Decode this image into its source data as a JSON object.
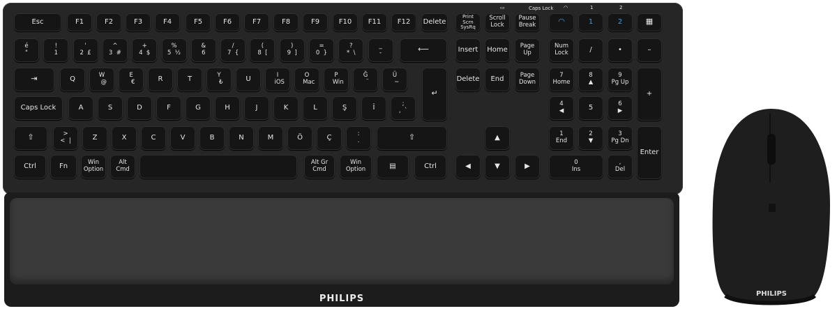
{
  "colors": {
    "keyboard": "#262626",
    "key": "#151515",
    "legend": "#e6e6e6",
    "bluetooth": "#3d9bea",
    "wrist_rest": "#3a3a3a",
    "mouse": "#1e1e1e"
  },
  "brand": {
    "keyboard": "PHILIPS",
    "mouse": "PHILIPS"
  },
  "indicators": {
    "caps_lock": "Caps Lock",
    "bt1": "1",
    "bt2": "2"
  },
  "keys": {
    "esc": "Esc",
    "f1": "F1",
    "f2": "F2",
    "f3": "F3",
    "f4": "F4",
    "f5": "F5",
    "f6": "F6",
    "f7": "F7",
    "f8": "F8",
    "f9": "F9",
    "f10": "F10",
    "f11": "F11",
    "f12": "F12",
    "delete_top": "Delete",
    "print": "Print\nScrn\nSysRq",
    "scroll": "Scroll\nLock",
    "pause": "Pause\nBreak",
    "bt1": "1",
    "bt2": "2",
    "r1": [
      "é\n\"",
      "!\n1",
      "'\n2  £",
      "^\n3  #",
      "+\n4  $",
      "%\n5  ½",
      "&\n6",
      "/\n7  {",
      "(\n8  [",
      ")\n9  ]",
      "=\n0  }",
      "?\n*  \\",
      "_\n-"
    ],
    "insert": "Insert",
    "home": "Home",
    "pgup": "Page\nUp",
    "numlock": "Num\nLock",
    "np_div": "/",
    "np_mul": "•",
    "np_min": "–",
    "r2": [
      "Q",
      "W\n  @",
      "E\n  €",
      "R",
      "T",
      "Y\n  ₺",
      "U",
      "I\n  iOS",
      "O\n  Mac",
      "P\n  Win",
      "Ğ\n  ¨",
      "Ü\n  ~"
    ],
    "del": "Delete",
    "end": "End",
    "pgdn": "Page\nDown",
    "np7": "7\nHome",
    "np8": "8\n▲",
    "np9": "9\nPg Up",
    "np_plus": "+",
    "caps": "Caps Lock",
    "r3": [
      "A",
      "S",
      "D",
      "F",
      "G",
      "H",
      "J",
      "K",
      "L",
      "Ş",
      "İ",
      ";\n,  `"
    ],
    "np4": "4\n◀",
    "np5": "5",
    "np6": "6\n▶",
    "r4": [
      ">\n<  |",
      "Z",
      "X",
      "C",
      "V",
      "B",
      "N",
      "M",
      "Ö",
      "Ç",
      ":\n."
    ],
    "up": "▲",
    "np1": "1\nEnd",
    "np2": "2\n▼",
    "np3": "3\nPg Dn",
    "enter": "Enter",
    "ctrl": "Ctrl",
    "fn": "Fn",
    "win_opt": "Win\nOption",
    "alt_cmd": "Alt\nCmd",
    "altgr_cmd": "Alt Gr\nCmd",
    "win_opt2": "Win\nOption",
    "menu": "▤",
    "ctrl2": "Ctrl",
    "left": "◀",
    "down": "▼",
    "right": "▶",
    "np0": "0\nIns",
    "np_dot": ",\nDel"
  }
}
